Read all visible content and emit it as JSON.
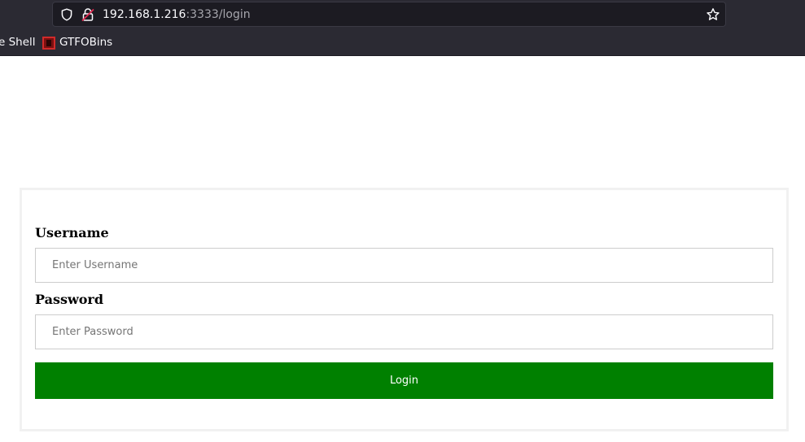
{
  "browser": {
    "url_host": "192.168.1.216",
    "url_rest": ":3333/login",
    "bookmarks": [
      {
        "label": "e Shell"
      },
      {
        "label": "GTFOBins",
        "icon": "gtfobins-favicon"
      }
    ],
    "icons": {
      "shield": "shield-icon",
      "lock": "insecure-lock-icon",
      "star": "bookmark-star-icon"
    }
  },
  "login_form": {
    "username_label": "Username",
    "username_placeholder": "Enter Username",
    "username_value": "",
    "password_label": "Password",
    "password_placeholder": "Enter Password",
    "password_value": "",
    "submit_label": "Login"
  },
  "colors": {
    "chrome_bg": "#2b2a33",
    "urlbar_bg": "#1c1b22",
    "button_bg": "#008000",
    "insecure_red": "#e22850"
  }
}
